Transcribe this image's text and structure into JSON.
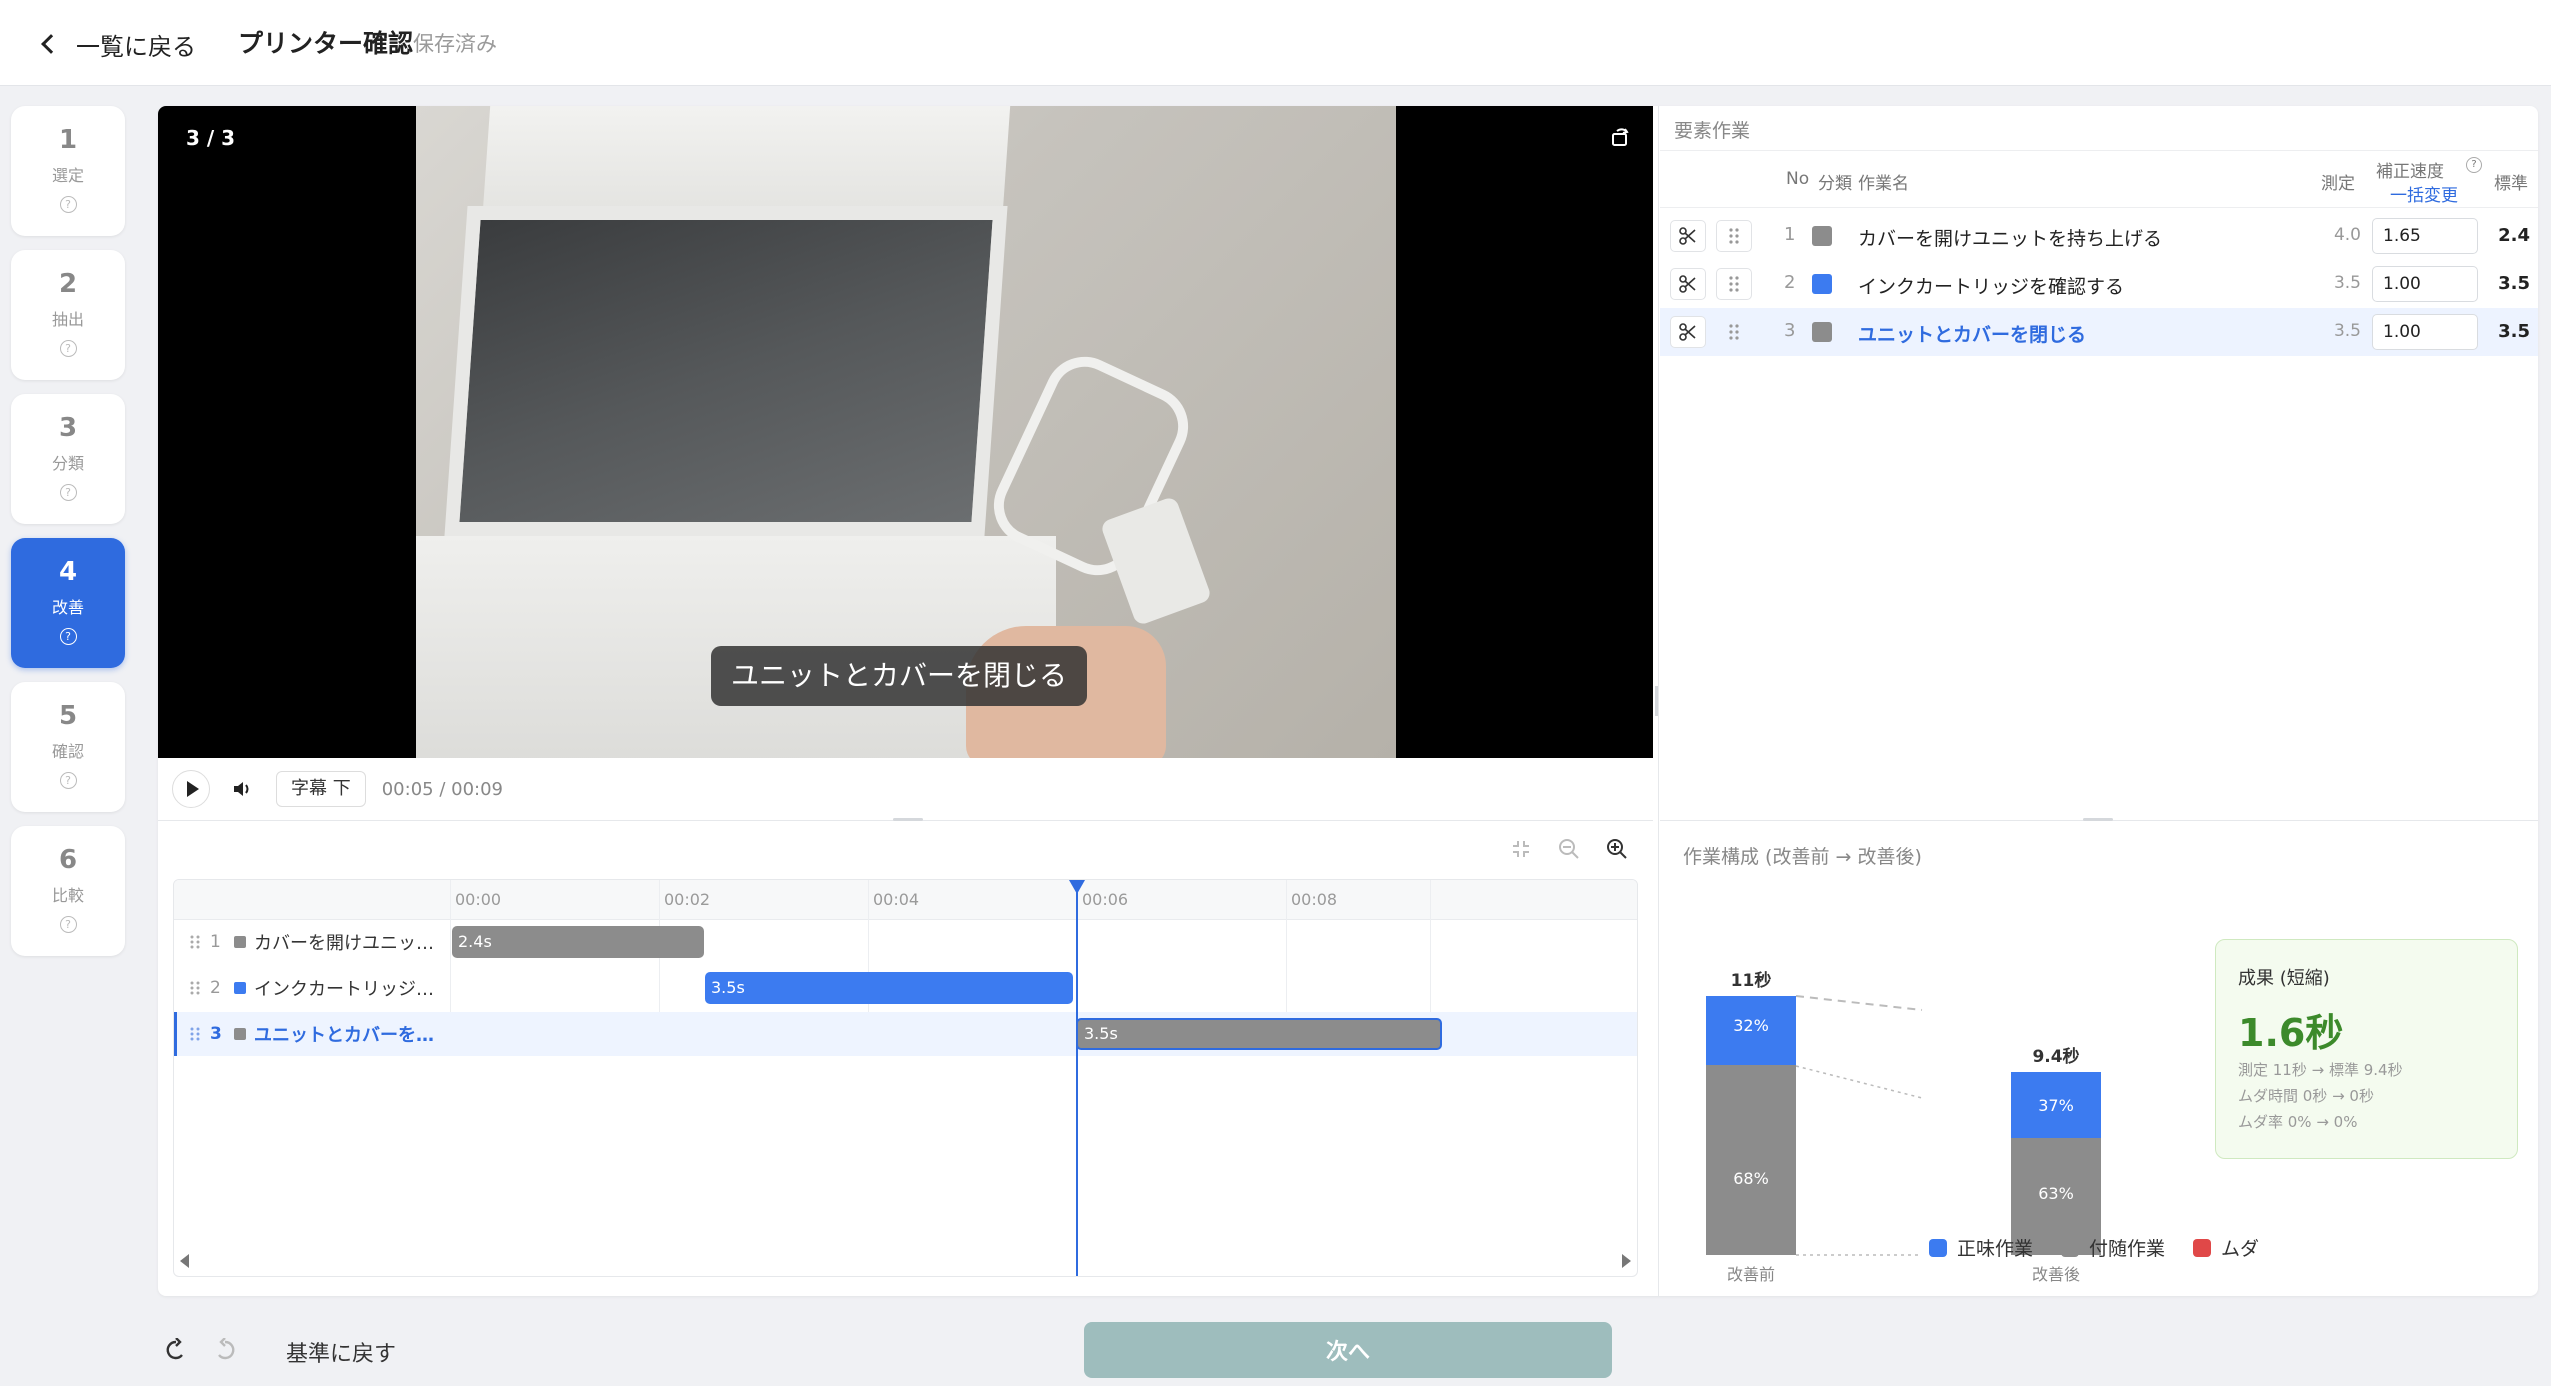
{
  "header": {
    "back_label": "一覧に戻る",
    "title": "プリンター確認",
    "save_status": "保存済み"
  },
  "steps": [
    {
      "num": "1",
      "label": "選定"
    },
    {
      "num": "2",
      "label": "抽出"
    },
    {
      "num": "3",
      "label": "分類"
    },
    {
      "num": "4",
      "label": "改善"
    },
    {
      "num": "5",
      "label": "確認"
    },
    {
      "num": "6",
      "label": "比較"
    }
  ],
  "active_step": 4,
  "video": {
    "counter": "3 / 3",
    "caption": "ユニットとカバーを閉じる",
    "subtitle_button": "字幕 下",
    "time": "00:05 / 00:09"
  },
  "timeline": {
    "ticks": [
      "00:00",
      "00:02",
      "00:04",
      "00:06",
      "00:08"
    ],
    "rows": [
      {
        "no": "1",
        "name": "カバーを開けユニッ…",
        "bar_label": "2.4s"
      },
      {
        "no": "2",
        "name": "インクカートリッジ…",
        "bar_label": "3.5s"
      },
      {
        "no": "3",
        "name": "ユニットとカバーを…",
        "bar_label": "3.5s"
      }
    ]
  },
  "elements_panel": {
    "title": "要素作業",
    "headers": {
      "no": "No",
      "cls": "分類",
      "name": "作業名",
      "measured": "測定",
      "speed": "補正速度",
      "bulk_change": "一括変更",
      "standard": "標準"
    },
    "rows": [
      {
        "no": "1",
        "cls_color": "#8c8c8c",
        "name": "カバーを開けユニットを持ち上げる",
        "measured": "4.0",
        "speed": "1.65",
        "standard": "2.4"
      },
      {
        "no": "2",
        "cls_color": "#3c7bf0",
        "name": "インクカートリッジを確認する",
        "measured": "3.5",
        "speed": "1.00",
        "standard": "3.5"
      },
      {
        "no": "3",
        "cls_color": "#8c8c8c",
        "name": "ユニットとカバーを閉じる",
        "measured": "3.5",
        "speed": "1.00",
        "standard": "3.5"
      }
    ]
  },
  "composition": {
    "title": "作業構成 (改善前 → 改善後)",
    "before": {
      "label": "改善前",
      "total": "11秒",
      "net_pct": "32%",
      "incidental_pct": "68%"
    },
    "after": {
      "label": "改善後",
      "total": "9.4秒",
      "net_pct": "37%",
      "incidental_pct": "63%"
    },
    "result": {
      "title": "成果 (短縮)",
      "value": "1.6秒",
      "line1": "測定 11秒 → 標準 9.4秒",
      "line2": "ムダ時間 0秒 → 0秒",
      "line3": "ムダ率 0% → 0%"
    },
    "legend": [
      {
        "label": "正味作業",
        "color": "#3c7bf0"
      },
      {
        "label": "付随作業",
        "color": "#8c8c8c"
      },
      {
        "label": "ムダ",
        "color": "#e04848"
      }
    ]
  },
  "footer": {
    "reset_label": "基準に戻す",
    "next_label": "次へ"
  }
}
